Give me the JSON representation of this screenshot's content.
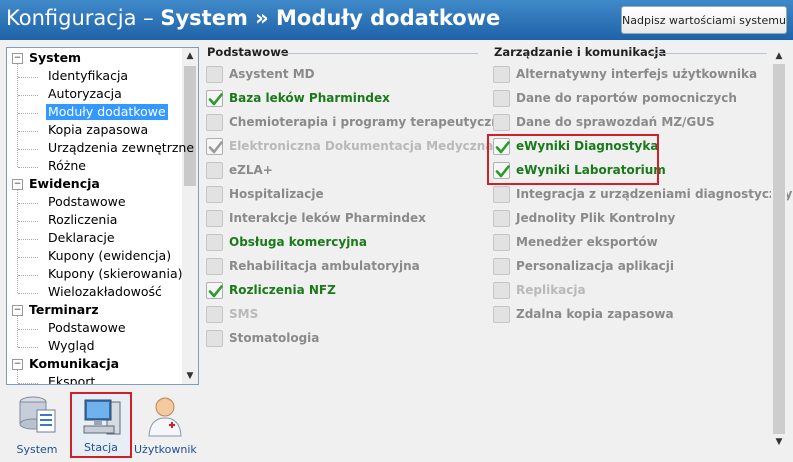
{
  "header": {
    "title_prefix": "Konfiguracja – ",
    "title_bold": "System » Moduły dodatkowe",
    "defaults_button": "Nadpisz wartościami systemu"
  },
  "tree": {
    "categories": [
      {
        "label": "System",
        "items": [
          "Identyfikacja",
          "Autoryzacja",
          "Moduły dodatkowe",
          "Kopia zapasowa",
          "Urządzenia zewnętrzne",
          "Różne"
        ]
      },
      {
        "label": "Ewidencja",
        "items": [
          "Podstawowe",
          "Rozliczenia",
          "Deklaracje",
          "Kupony (ewidencja)",
          "Kupony (skierowania)",
          "Wielozakładowość"
        ]
      },
      {
        "label": "Terminarz",
        "items": [
          "Podstawowe",
          "Wygląd"
        ]
      },
      {
        "label": "Komunikacja",
        "items": [
          "Eksport"
        ]
      }
    ],
    "selected": "Moduły dodatkowe",
    "expander_symbol": "−"
  },
  "bottom_nav": [
    {
      "label": "System",
      "icon": "database-list-icon",
      "active": false
    },
    {
      "label": "Stacja",
      "icon": "workstation-computer-icon",
      "active": true
    },
    {
      "label": "Użytkownik",
      "icon": "doctor-user-icon",
      "active": false
    }
  ],
  "sections": {
    "basic": {
      "title": "Podstawowe",
      "modules": [
        {
          "label": "Asystent MD",
          "checked": false,
          "disabled": false
        },
        {
          "label": "Baza leków Pharmindex",
          "checked": true,
          "disabled": false
        },
        {
          "label": "Chemioterapia i programy terapeutyczne",
          "checked": false,
          "disabled": false
        },
        {
          "label": "Elektroniczna Dokumentacja Medyczna",
          "checked": true,
          "disabled": true
        },
        {
          "label": "eZLA+",
          "checked": false,
          "disabled": false
        },
        {
          "label": "Hospitalizacje",
          "checked": false,
          "disabled": false
        },
        {
          "label": "Interakcje leków Pharmindex",
          "checked": false,
          "disabled": false
        },
        {
          "label": "Obsługa komercyjna",
          "checked": false,
          "disabled": false,
          "green": true
        },
        {
          "label": "Rehabilitacja ambulatoryjna",
          "checked": false,
          "disabled": false
        },
        {
          "label": "Rozliczenia NFZ",
          "checked": true,
          "disabled": false
        },
        {
          "label": "SMS",
          "checked": false,
          "disabled": true
        },
        {
          "label": "Stomatologia",
          "checked": false,
          "disabled": false
        }
      ]
    },
    "management": {
      "title": "Zarządzanie i komunikacja",
      "modules": [
        {
          "label": "Alternatywny interfejs użytkownika",
          "checked": false,
          "disabled": false
        },
        {
          "label": "Dane do raportów pomocniczych",
          "checked": false,
          "disabled": false
        },
        {
          "label": "Dane do sprawozdań MZ/GUS",
          "checked": false,
          "disabled": false
        },
        {
          "label": "eWyniki Diagnostyka",
          "checked": true,
          "disabled": false
        },
        {
          "label": "eWyniki Laboratorium",
          "checked": true,
          "disabled": false
        },
        {
          "label": "Integracja z urządzeniami diagnostycznymi",
          "checked": false,
          "disabled": false
        },
        {
          "label": "Jednolity Plik Kontrolny",
          "checked": false,
          "disabled": false
        },
        {
          "label": "Menedżer eksportów",
          "checked": false,
          "disabled": false
        },
        {
          "label": "Personalizacja aplikacji",
          "checked": false,
          "disabled": false
        },
        {
          "label": "Replikacja",
          "checked": false,
          "disabled": true
        },
        {
          "label": "Zdalna kopia zapasowa",
          "checked": false,
          "disabled": false
        }
      ]
    }
  },
  "colors": {
    "header_top": "#3f8ac9",
    "header_bottom": "#1f62a8",
    "checked_text": "#1a7a1a",
    "unchecked_text": "#8a8a8a",
    "disabled_text": "#b9b9b9",
    "highlight_border": "#d0202a",
    "selection": "#3399ff"
  }
}
